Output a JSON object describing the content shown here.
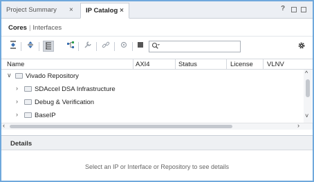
{
  "tabs": [
    {
      "label": "Project Summary",
      "close": "×"
    },
    {
      "label": "IP Catalog",
      "close": "×"
    }
  ],
  "window_controls": {
    "help": "?"
  },
  "subnav": {
    "cores": "Cores",
    "separator": "|",
    "interfaces": "Interfaces"
  },
  "toolbar": {
    "icons": [
      "collapse-all-icon",
      "expand-all-icon",
      "hierarchy-icon",
      "network-icon",
      "wrench-icon",
      "link-icon",
      "chip-icon",
      "stop-icon",
      "search-icon",
      "gear-icon"
    ],
    "search_placeholder": ""
  },
  "table": {
    "columns": [
      "Name",
      "AXI4",
      "Status",
      "License",
      "VLNV"
    ],
    "rows": [
      {
        "chevron": "∨",
        "label": "Vivado Repository"
      },
      {
        "chevron": "›",
        "label": "SDAccel DSA Infrastructure"
      },
      {
        "chevron": "›",
        "label": "Debug & Verification"
      },
      {
        "chevron": "›",
        "label": "BaseIP"
      }
    ]
  },
  "details": {
    "title": "Details",
    "message": "Select an IP or Interface or Repository to see details"
  },
  "colors": {
    "frame": "#6fa8dc",
    "accent": "#3a6fb0"
  }
}
